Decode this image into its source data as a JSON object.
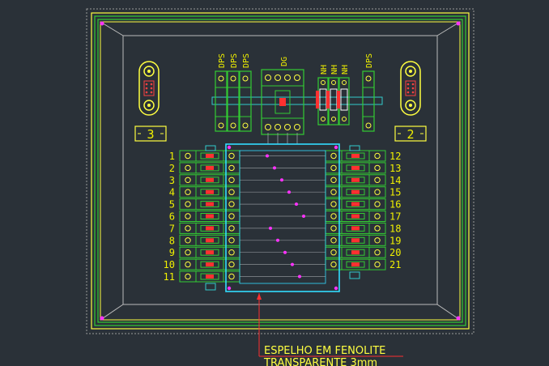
{
  "drawing": {
    "side_labels": {
      "left": "3",
      "right": "2"
    },
    "top_labels": {
      "dps_left": [
        "DPS",
        "DPS",
        "DPS"
      ],
      "dg": "DG",
      "nh": [
        "NH",
        "NH",
        "NH"
      ],
      "dps_right": "DPS"
    },
    "left_numbers": [
      "1",
      "2",
      "3",
      "4",
      "5",
      "6",
      "7",
      "8",
      "9",
      "10",
      "11"
    ],
    "right_numbers": [
      "12",
      "13",
      "14",
      "15",
      "16",
      "17",
      "18",
      "19",
      "20",
      "21"
    ],
    "note": {
      "line1": "ESPELHO EM FENOLITE",
      "line2": "TRANSPARENTE 3mm"
    }
  }
}
